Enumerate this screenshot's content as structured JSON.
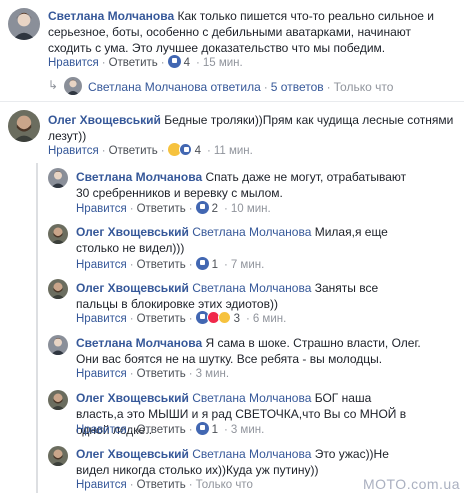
{
  "comments": [
    {
      "author": "Светлана Молчанова",
      "text": "Как только пишется что-то реально сильное и серьезное, боты, особенно с дебильными аватарками, начинают сходить с ума. Это лучшее доказательство что мы победим.",
      "like": "Нравится",
      "reply": "Ответить",
      "count": "4",
      "time": "15 мин."
    },
    {
      "author": "Олег Хвощевський",
      "text": "Бедные троляки))Прям как чудища лесные сотнями лезут))",
      "like": "Нравится",
      "reply": "Ответить",
      "count": "4",
      "time": "11 мин."
    }
  ],
  "collapsed_reply": {
    "author": "Светлана Молчанова",
    "action": "ответила",
    "replies": "5 ответов",
    "status": "Только что"
  },
  "replies": [
    {
      "author": "Светлана Молчанова",
      "mention": "",
      "text": "Спать даже не могут, отрабатывают 30 сребренников и веревку с мылом.",
      "like": "Нравится",
      "reply": "Ответить",
      "count": "2",
      "time": "10 мин."
    },
    {
      "author": "Олег Хвощевський",
      "mention": "Светлана Молчанова",
      "text": "Милая,я еще столько не видел)))",
      "like": "Нравится",
      "reply": "Ответить",
      "count": "1",
      "time": "7 мин."
    },
    {
      "author": "Олег Хвощевський",
      "mention": "Светлана Молчанова",
      "text": "Заняты все пальцы в блокировке этих эдиотов))",
      "like": "Нравится",
      "reply": "Ответить",
      "count": "3",
      "time": "6 мин."
    },
    {
      "author": "Светлана Молчанова",
      "mention": "",
      "text": "Я сама в шоке. Страшно власти, Олег. Они вас боятся не на шутку. Все ребята - вы молодцы.",
      "like": "Нравится",
      "reply": "Ответить",
      "count": "",
      "time": "3 мин."
    },
    {
      "author": "Олег Хвощевський",
      "mention": "Светлана Молчанова",
      "text": "БОГ наша власть,а это МЫШИ и я рад СВЕТОЧКА,что Вы со МНОЙ в одной лодке..",
      "like": "Нравится",
      "reply": "Ответить",
      "count": "1",
      "time": "3 мин."
    },
    {
      "author": "Олег Хвощевський",
      "mention": "Светлана Молчанова",
      "text": "Это ужас))Не видел никогда столько их))Куда уж путину))",
      "like": "Нравится",
      "reply": "Ответить",
      "count": "",
      "time": "Только что"
    }
  ],
  "watermark": "MOTO.com.ua",
  "colors": {
    "name": "#365899",
    "meta": "#90949c",
    "text": "#1d2129",
    "like_reaction": "#4267b2"
  }
}
